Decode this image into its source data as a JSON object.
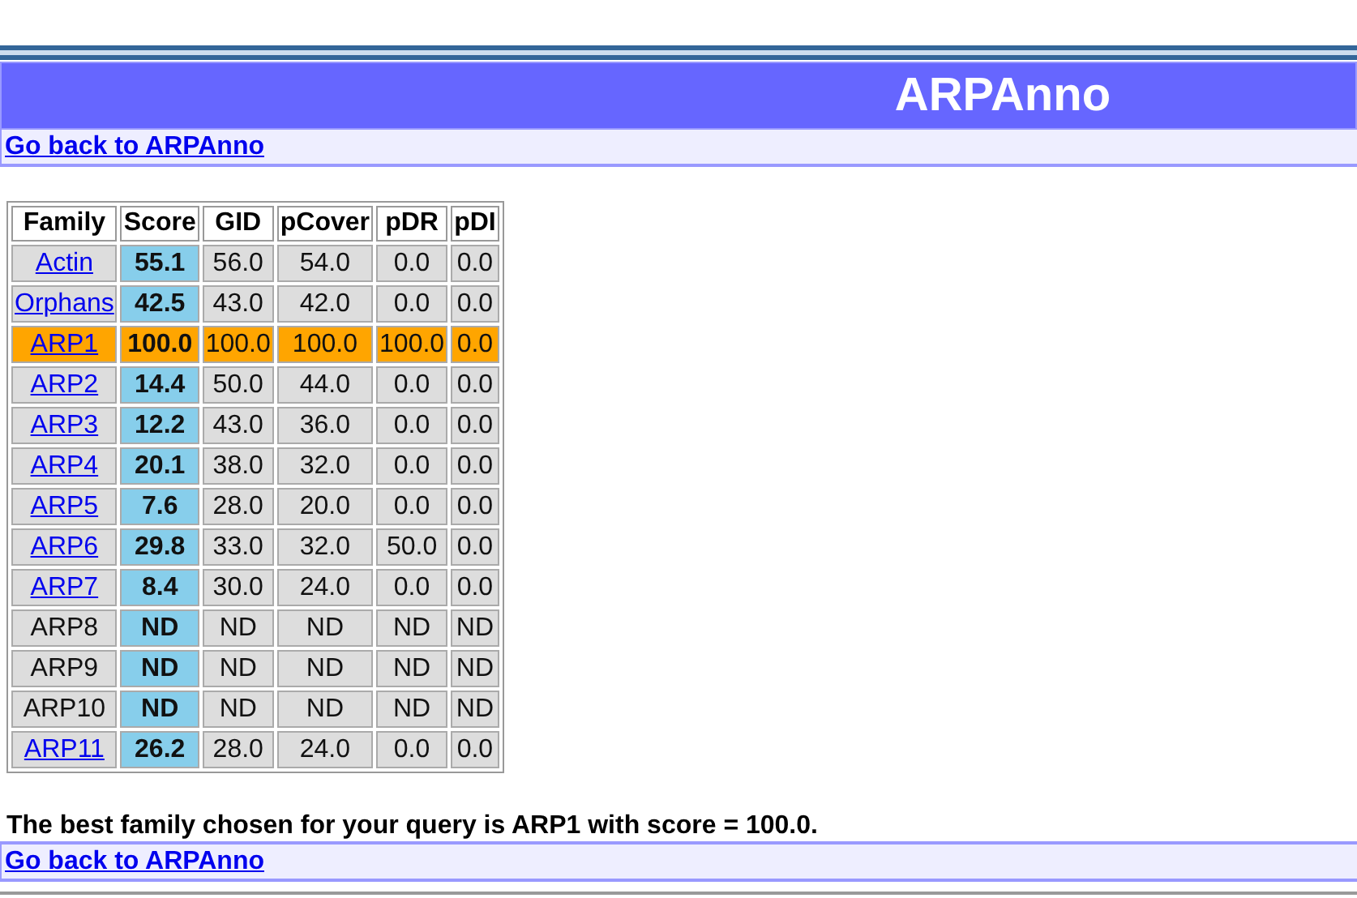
{
  "header": {
    "title": "ARPAnno"
  },
  "top_link": "Go back to ARPAnno",
  "table": {
    "columns": [
      "Family",
      "Score",
      "GID",
      "pCover",
      "pDR",
      "pDI"
    ],
    "rows": [
      {
        "linked": true,
        "selected": false,
        "cells": [
          "Actin",
          "55.1",
          "56.0",
          "54.0",
          "0.0",
          "0.0"
        ]
      },
      {
        "linked": true,
        "selected": false,
        "cells": [
          "Orphans",
          "42.5",
          "43.0",
          "42.0",
          "0.0",
          "0.0"
        ]
      },
      {
        "linked": true,
        "selected": true,
        "cells": [
          "ARP1",
          "100.0",
          "100.0",
          "100.0",
          "100.0",
          "0.0"
        ]
      },
      {
        "linked": true,
        "selected": false,
        "cells": [
          "ARP2",
          "14.4",
          "50.0",
          "44.0",
          "0.0",
          "0.0"
        ]
      },
      {
        "linked": true,
        "selected": false,
        "cells": [
          "ARP3",
          "12.2",
          "43.0",
          "36.0",
          "0.0",
          "0.0"
        ]
      },
      {
        "linked": true,
        "selected": false,
        "cells": [
          "ARP4",
          "20.1",
          "38.0",
          "32.0",
          "0.0",
          "0.0"
        ]
      },
      {
        "linked": true,
        "selected": false,
        "cells": [
          "ARP5",
          "7.6",
          "28.0",
          "20.0",
          "0.0",
          "0.0"
        ]
      },
      {
        "linked": true,
        "selected": false,
        "cells": [
          "ARP6",
          "29.8",
          "33.0",
          "32.0",
          "50.0",
          "0.0"
        ]
      },
      {
        "linked": true,
        "selected": false,
        "cells": [
          "ARP7",
          "8.4",
          "30.0",
          "24.0",
          "0.0",
          "0.0"
        ]
      },
      {
        "linked": false,
        "selected": false,
        "cells": [
          "ARP8",
          "ND",
          "ND",
          "ND",
          "ND",
          "ND"
        ]
      },
      {
        "linked": false,
        "selected": false,
        "cells": [
          "ARP9",
          "ND",
          "ND",
          "ND",
          "ND",
          "ND"
        ]
      },
      {
        "linked": false,
        "selected": false,
        "cells": [
          "ARP10",
          "ND",
          "ND",
          "ND",
          "ND",
          "ND"
        ]
      },
      {
        "linked": true,
        "selected": false,
        "cells": [
          "ARP11",
          "26.2",
          "28.0",
          "24.0",
          "0.0",
          "0.0"
        ]
      }
    ]
  },
  "result": "The best family chosen for your query is ARP1 with score = 100.0.",
  "bottom_link": "Go back to ARPAnno"
}
